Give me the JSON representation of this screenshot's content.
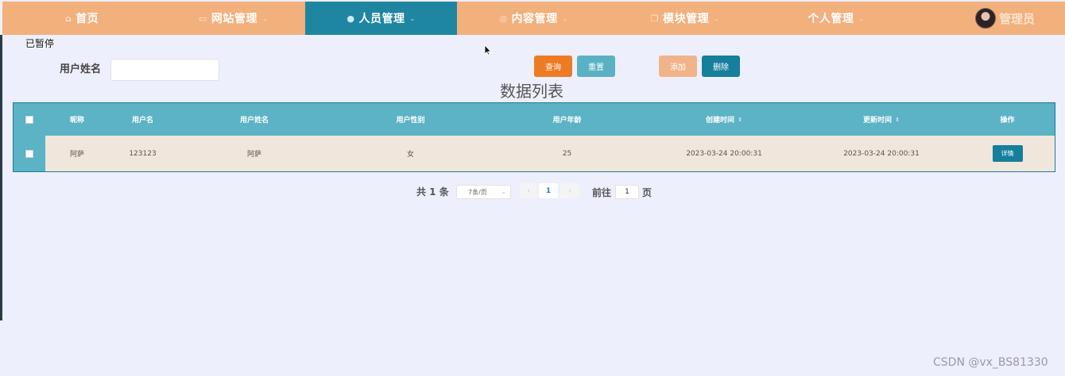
{
  "nav": {
    "items": [
      {
        "label": "首页",
        "icon": "home-icon",
        "glyph": "⌂",
        "caret": false,
        "active": false
      },
      {
        "label": "网站管理",
        "icon": "monitor-icon",
        "glyph": "▭",
        "caret": true,
        "active": false
      },
      {
        "label": "人员管理",
        "icon": "user-icon",
        "glyph": "●",
        "caret": true,
        "active": true
      },
      {
        "label": "内容管理",
        "icon": "settings-icon",
        "glyph": "◎",
        "caret": true,
        "active": false
      },
      {
        "label": "模块管理",
        "icon": "module-icon",
        "glyph": "❐",
        "caret": true,
        "active": false
      },
      {
        "label": "个人管理",
        "icon": "",
        "glyph": "",
        "caret": true,
        "active": false
      }
    ],
    "caret_glyph": "⌄",
    "user": {
      "name": "管理员"
    }
  },
  "paused_text": "已暂停",
  "search": {
    "label": "用户姓名",
    "value": "",
    "placeholder": ""
  },
  "buttons": {
    "query": "查询",
    "reset": "重置",
    "add": "添加",
    "delete": "删除"
  },
  "list_title": "数据列表",
  "table": {
    "columns": [
      "昵称",
      "用户名",
      "用户姓名",
      "用户性别",
      "用户年龄",
      "创建时间",
      "更新时间",
      "操作"
    ],
    "sort_glyph": "⇕",
    "rows": [
      {
        "nickname": "阿萨",
        "username": "123123",
        "realname": "阿萨",
        "gender": "女",
        "age": "25",
        "created": "2023-03-24 20:00:31",
        "updated": "2023-03-24 20:00:31",
        "action": "详情"
      }
    ]
  },
  "pagination": {
    "total": "共 1 条",
    "page_size": "7条/页",
    "prev": "‹",
    "current_page": "1",
    "next": "›",
    "goto_label": "前往",
    "goto_value": "1",
    "goto_unit": "页"
  },
  "watermark": "CSDN @vx_BS81330",
  "colors": {
    "nav_bg": "#f2b07d",
    "nav_active": "#1f86a2",
    "table_header": "#5bb3c5",
    "row_bg": "#f1e6dc",
    "page_bg": "#eeeffd"
  }
}
